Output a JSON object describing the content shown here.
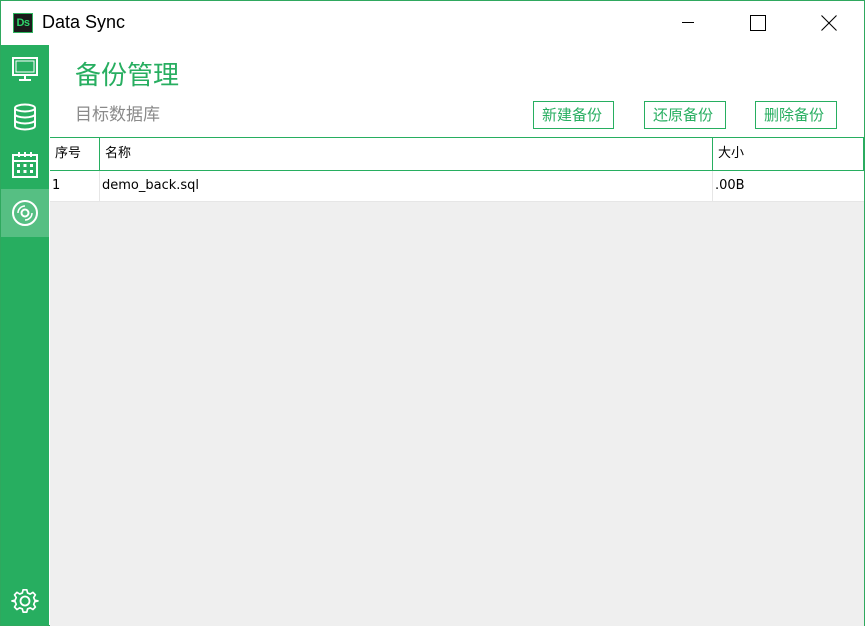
{
  "window": {
    "title": "Data Sync",
    "logo_text": "Ds",
    "controls": [
      "minimize-icon",
      "maximize-icon",
      "close-icon"
    ]
  },
  "sidebar": {
    "items": [
      {
        "icon": "monitor-icon",
        "active": false
      },
      {
        "icon": "database-icon",
        "active": false
      },
      {
        "icon": "calendar-icon",
        "active": false
      },
      {
        "icon": "disc-icon",
        "active": true
      }
    ],
    "footer_icon": "gear-icon"
  },
  "page": {
    "title": "备份管理",
    "subtitle": "目标数据库"
  },
  "toolbar": {
    "new_label": "新建备份",
    "restore_label": "还原备份",
    "delete_label": "删除备份"
  },
  "table": {
    "columns": [
      "序号",
      "名称",
      "大小"
    ],
    "rows": [
      {
        "index": "1",
        "name": "demo_back.sql",
        "size": ".00B"
      }
    ]
  },
  "colors": {
    "accent": "#27ae60",
    "subtitle": "#8a8a8a",
    "grid_background": "#efefef"
  }
}
